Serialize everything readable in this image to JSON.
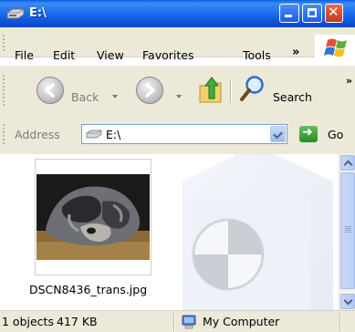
{
  "window": {
    "title": "E:\\"
  },
  "menu": {
    "items": [
      "File",
      "Edit",
      "View",
      "Favorites",
      "Tools"
    ],
    "more": "»"
  },
  "toolbar": {
    "back_label": "Back",
    "search_label": "Search",
    "more": "»"
  },
  "address": {
    "label": "Address",
    "value": "E:\\",
    "go_label": "Go"
  },
  "files": [
    {
      "name": "DSCN8436_trans.jpg"
    }
  ],
  "status": {
    "objects": "1 objects",
    "size": "417 KB",
    "location": "My Computer"
  },
  "colors": {
    "titlebar": "#0d54d6",
    "chrome": "#ece9d8",
    "close_button": "#c5381c"
  }
}
